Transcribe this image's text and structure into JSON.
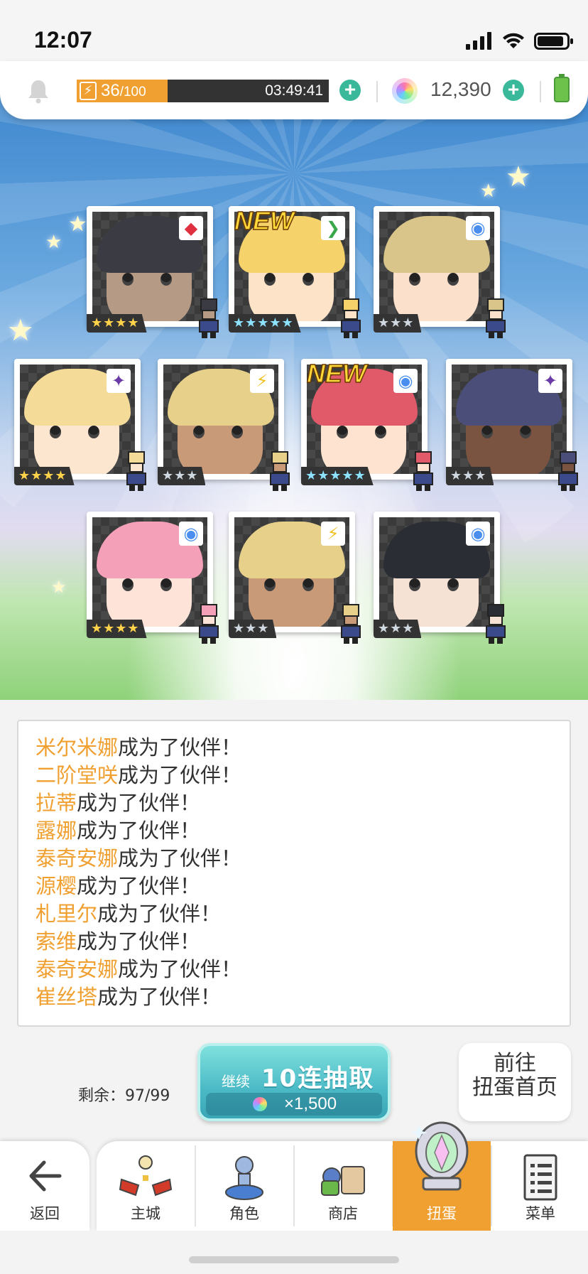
{
  "status_bar": {
    "time": "12:07"
  },
  "resources": {
    "stamina_current": "36",
    "stamina_max": "/100",
    "stamina_timer": "03:49:41",
    "stamina_fill": 0.36,
    "gems": "12,390"
  },
  "cards": [
    {
      "rarity": "★★★★",
      "tier": "gold",
      "element": "◆",
      "element_color": "#e03040",
      "is_new": false,
      "hair": "#3b3b44",
      "skin": "#b59a86"
    },
    {
      "rarity": "★★★★★",
      "tier": "rb",
      "element": "❯",
      "element_color": "#3aa84a",
      "is_new": true,
      "hair": "#f5d26a",
      "skin": "#fde3c8"
    },
    {
      "rarity": "★★★",
      "tier": "silver",
      "element": "◉",
      "element_color": "#4a8ff0",
      "is_new": false,
      "hair": "#d9c58a",
      "skin": "#fbe0cc"
    },
    {
      "rarity": "★★★★",
      "tier": "gold",
      "element": "✦",
      "element_color": "#6a3aa8",
      "is_new": false,
      "hair": "#f4dc98",
      "skin": "#fde6cf"
    },
    {
      "rarity": "★★★",
      "tier": "silver",
      "element": "⚡",
      "element_color": "#f0c020",
      "is_new": false,
      "hair": "#e6d08a",
      "skin": "#c99a78"
    },
    {
      "rarity": "★★★★★",
      "tier": "rb",
      "element": "◉",
      "element_color": "#4a8ff0",
      "is_new": true,
      "hair": "#e05a6a",
      "skin": "#fde3d0"
    },
    {
      "rarity": "★★★",
      "tier": "silver",
      "element": "✦",
      "element_color": "#6a3aa8",
      "is_new": false,
      "hair": "#4a4e78",
      "skin": "#7a5440"
    },
    {
      "rarity": "★★★★",
      "tier": "gold",
      "element": "◉",
      "element_color": "#4a8ff0",
      "is_new": false,
      "hair": "#f4a0b8",
      "skin": "#fde3d8"
    },
    {
      "rarity": "★★★",
      "tier": "silver",
      "element": "⚡",
      "element_color": "#f0c020",
      "is_new": false,
      "hair": "#e6d08a",
      "skin": "#c99a78"
    },
    {
      "rarity": "★★★",
      "tier": "silver",
      "element": "◉",
      "element_color": "#4a8ff0",
      "is_new": false,
      "hair": "#2a2d33",
      "skin": "#f6e2d4"
    }
  ],
  "new_label": "NEW",
  "log": [
    {
      "name": "米尔米娜",
      "suffix": "成为了伙伴！"
    },
    {
      "name": "二阶堂咲",
      "suffix": "成为了伙伴！"
    },
    {
      "name": "拉蒂",
      "suffix": "成为了伙伴！"
    },
    {
      "name": "露娜",
      "suffix": "成为了伙伴！"
    },
    {
      "name": "泰奇安娜",
      "suffix": "成为了伙伴！"
    },
    {
      "name": "源樱",
      "suffix": "成为了伙伴！"
    },
    {
      "name": "札里尔",
      "suffix": "成为了伙伴！"
    },
    {
      "name": "索维",
      "suffix": "成为了伙伴！"
    },
    {
      "name": "泰奇安娜",
      "suffix": "成为了伙伴！"
    },
    {
      "name": "崔丝塔",
      "suffix": "成为了伙伴！"
    }
  ],
  "actions": {
    "remaining": "剩余：97/99",
    "continue_label": "继续",
    "pull_label": "10连抽取",
    "pull_cost": "×1,500",
    "goto_line1": "前往",
    "goto_line2": "扭蛋首页"
  },
  "nav": {
    "back": "返回",
    "items": [
      "主城",
      "角色",
      "商店",
      "扭蛋",
      "菜单"
    ],
    "active": "扭蛋"
  },
  "colors": {
    "accent": "#f0a030",
    "teal": "#3ab89a"
  }
}
